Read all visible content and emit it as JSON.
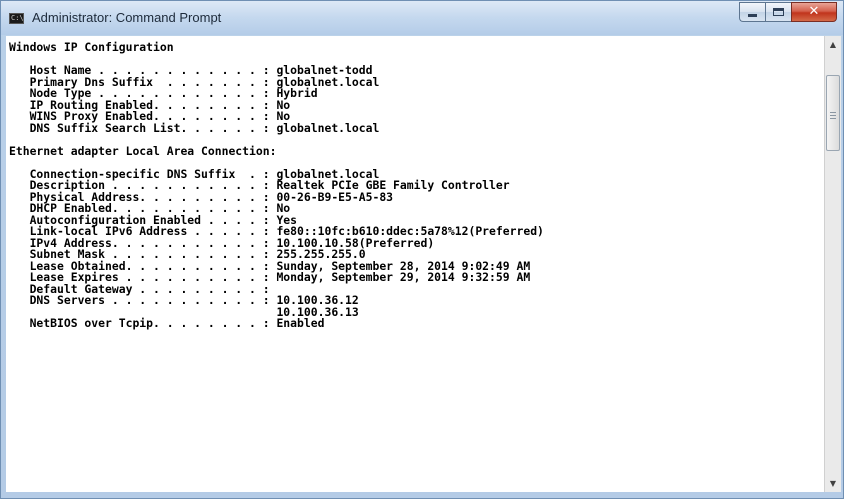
{
  "window": {
    "title": "Administrator: Command Prompt",
    "icon_name": "cmd-icon",
    "icon_text": "C:\\_"
  },
  "caption_buttons": {
    "minimize_icon": "minimize-icon",
    "maximize_icon": "maximize-icon",
    "close_icon": "close-icon",
    "close_label": "✕"
  },
  "console": {
    "lines": [
      "Windows IP Configuration",
      "",
      "   Host Name . . . . . . . . . . . . : globalnet-todd",
      "   Primary Dns Suffix  . . . . . . . : globalnet.local",
      "   Node Type . . . . . . . . . . . . : Hybrid",
      "   IP Routing Enabled. . . . . . . . : No",
      "   WINS Proxy Enabled. . . . . . . . : No",
      "   DNS Suffix Search List. . . . . . : globalnet.local",
      "",
      "Ethernet adapter Local Area Connection:",
      "",
      "   Connection-specific DNS Suffix  . : globalnet.local",
      "   Description . . . . . . . . . . . : Realtek PCIe GBE Family Controller",
      "   Physical Address. . . . . . . . . : 00-26-B9-E5-A5-83",
      "   DHCP Enabled. . . . . . . . . . . : No",
      "   Autoconfiguration Enabled . . . . : Yes",
      "   Link-local IPv6 Address . . . . . : fe80::10fc:b610:ddec:5a78%12(Preferred)",
      "   IPv4 Address. . . . . . . . . . . : 10.100.10.58(Preferred)",
      "   Subnet Mask . . . . . . . . . . . : 255.255.255.0",
      "   Lease Obtained. . . . . . . . . . : Sunday, September 28, 2014 9:02:49 AM",
      "   Lease Expires . . . . . . . . . . : Monday, September 29, 2014 9:32:59 AM",
      "   Default Gateway . . . . . . . . . :",
      "   DNS Servers . . . . . . . . . . . : 10.100.36.12",
      "                                       10.100.36.13",
      "   NetBIOS over Tcpip. . . . . . . . : Enabled"
    ]
  },
  "scrollbar": {
    "up_icon": "scroll-up-arrow-icon",
    "down_icon": "scroll-down-arrow-icon",
    "up_glyph": "▲",
    "down_glyph": "▼",
    "position_fraction": 0.1
  }
}
